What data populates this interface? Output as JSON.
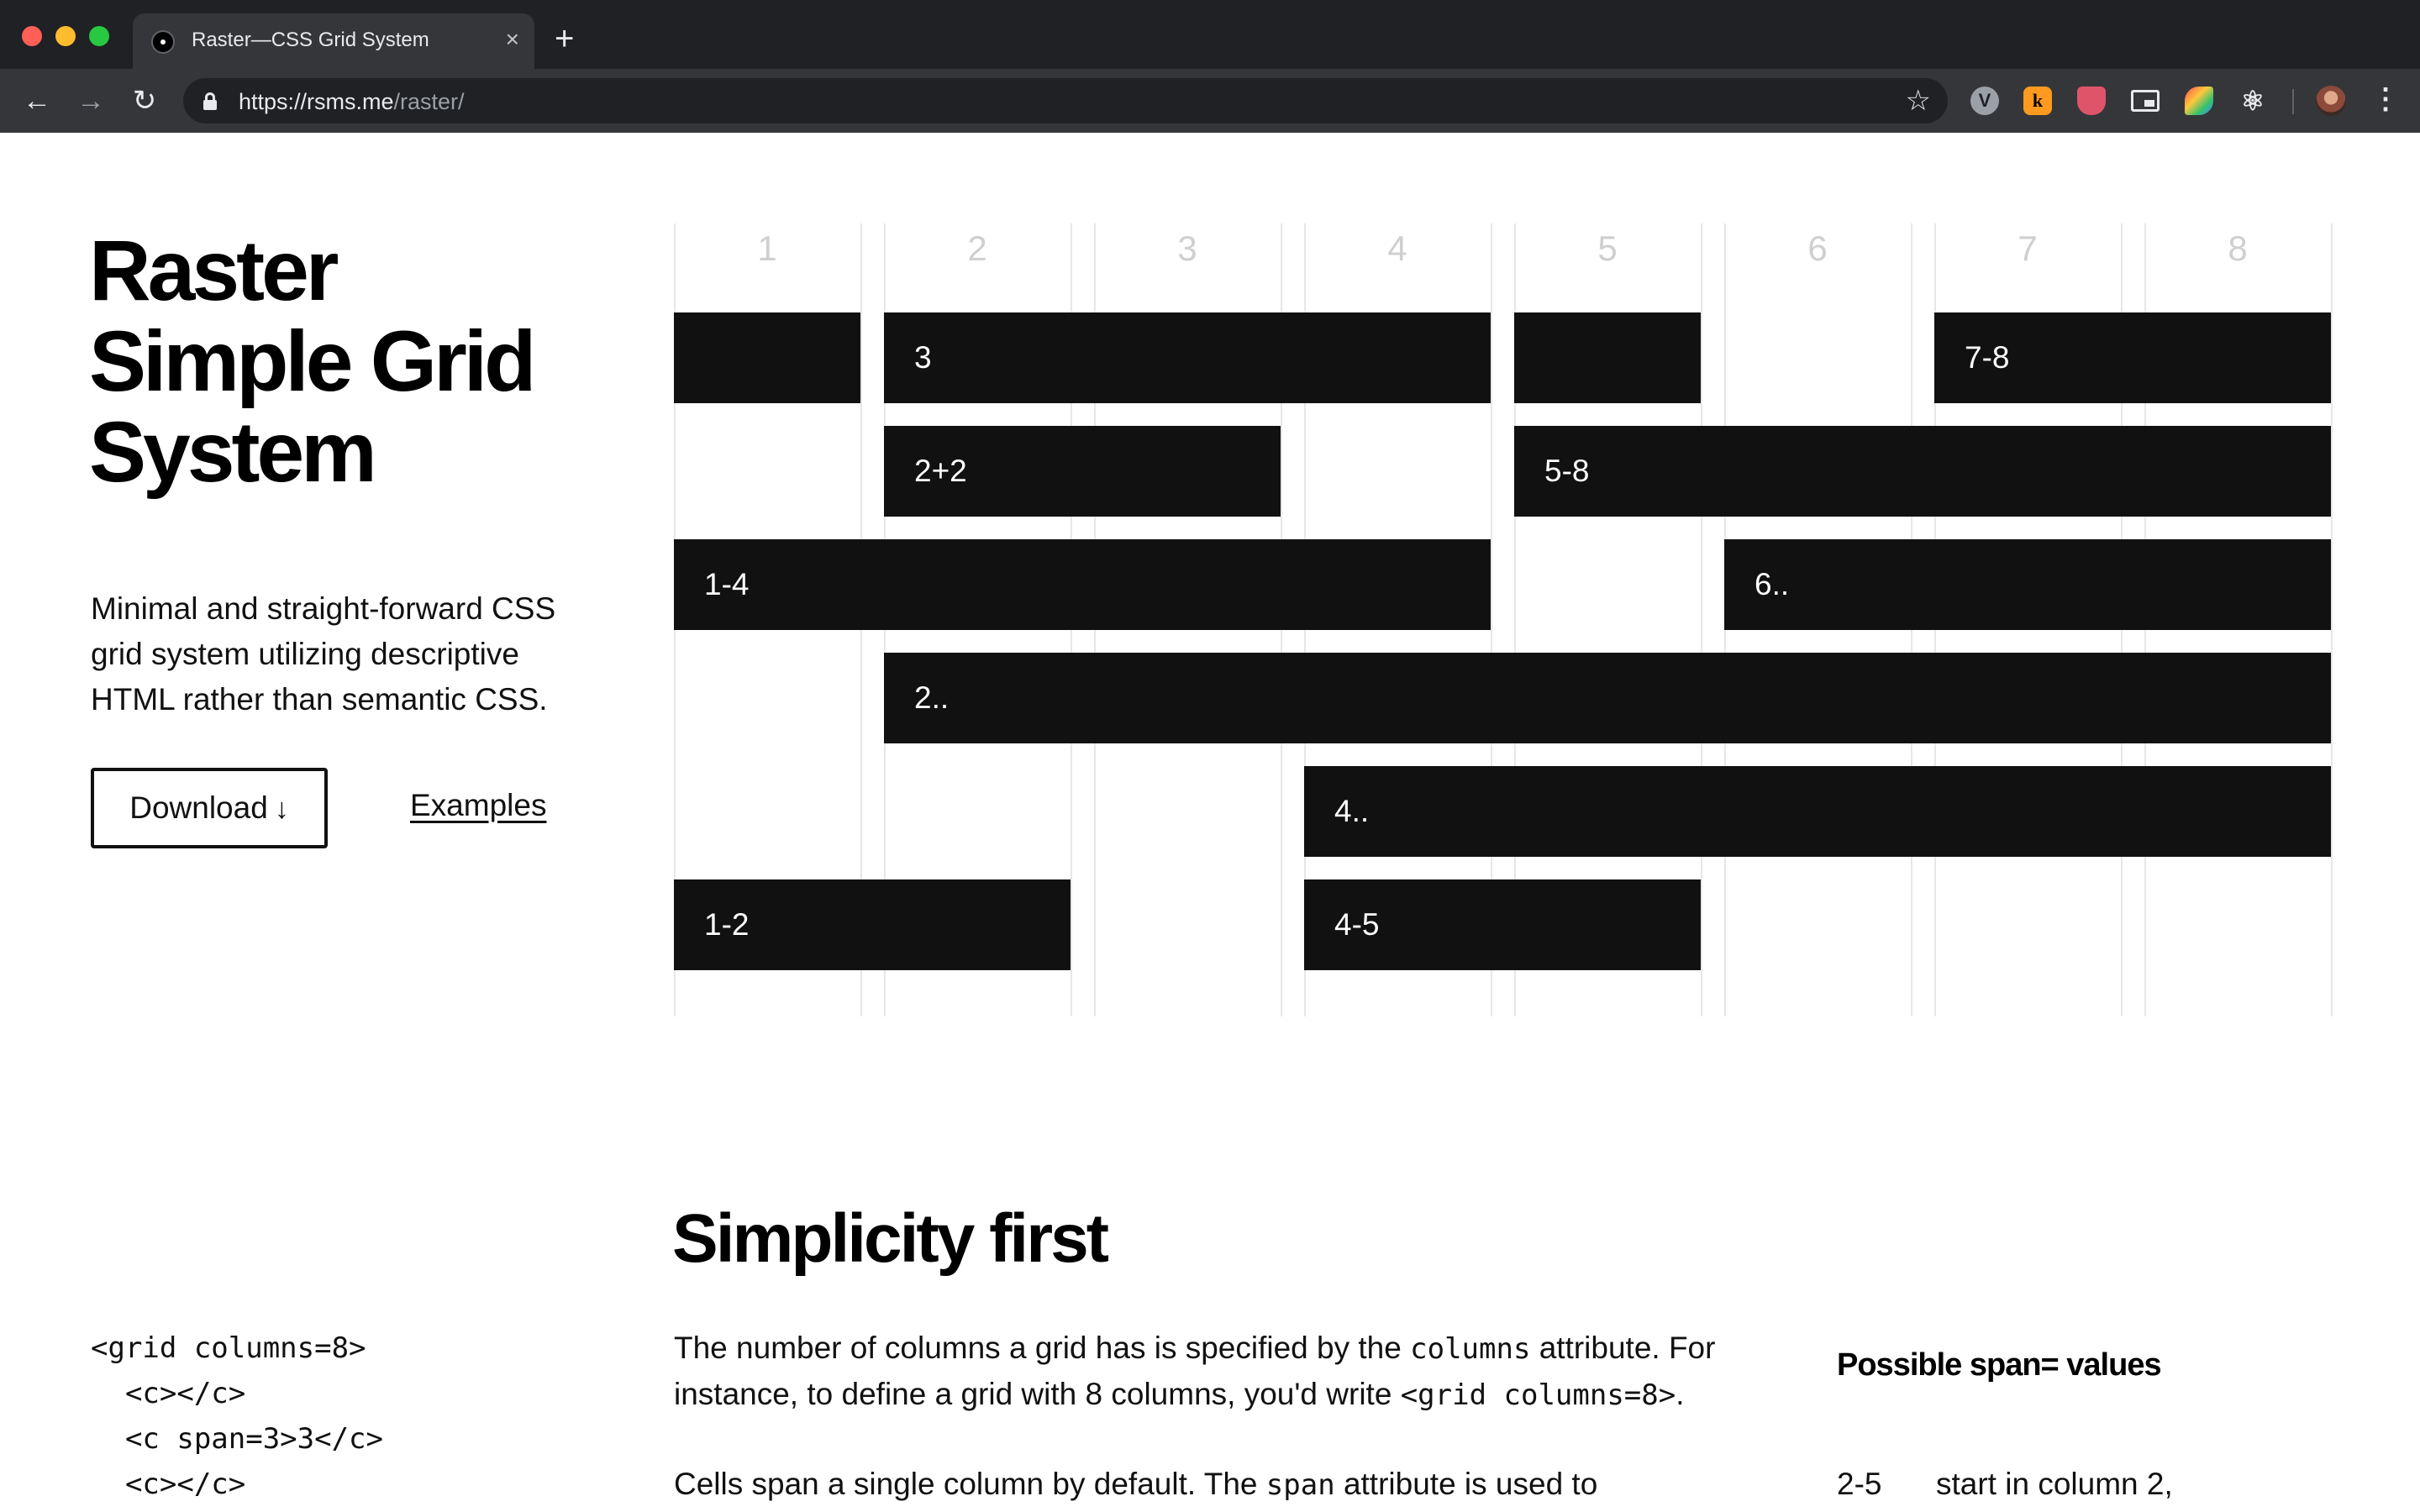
{
  "browser": {
    "tab_title": "Raster—CSS Grid System",
    "tab_close": "×",
    "new_tab": "+",
    "url_host": "https://rsms.me",
    "url_path": "/raster/",
    "back": "←",
    "forward": "→",
    "reload": "↻",
    "star": "☆",
    "ext_v": "V",
    "ext_k": "k",
    "ext_react": "⚛",
    "menu": "⋮"
  },
  "hero": {
    "title_lines": [
      "Raster",
      "Simple Grid",
      "System"
    ],
    "description": "Minimal and straight-forward CSS grid system utilizing descriptive HTML rather than semantic CSS.",
    "download_label": "Download",
    "download_arrow": "↓",
    "examples_label": "Examples"
  },
  "grid_demo": {
    "column_numbers": [
      "1",
      "2",
      "3",
      "4",
      "5",
      "6",
      "7",
      "8"
    ],
    "cells": [
      {
        "label": "",
        "start": 1,
        "span": 1,
        "row": 1
      },
      {
        "label": "3",
        "start": 2,
        "span": 3,
        "row": 1
      },
      {
        "label": "",
        "start": 5,
        "span": 1,
        "row": 1
      },
      {
        "label": "7-8",
        "start": 7,
        "span": 2,
        "row": 1
      },
      {
        "label": "2+2",
        "start": 2,
        "span": 2,
        "row": 2
      },
      {
        "label": "5-8",
        "start": 5,
        "span": 4,
        "row": 2
      },
      {
        "label": "1-4",
        "start": 1,
        "span": 4,
        "row": 3
      },
      {
        "label": "6..",
        "start": 6,
        "span": 3,
        "row": 3
      },
      {
        "label": "2..",
        "start": 2,
        "span": 7,
        "row": 4
      },
      {
        "label": "4..",
        "start": 4,
        "span": 5,
        "row": 5
      },
      {
        "label": "1-2",
        "start": 1,
        "span": 2,
        "row": 6
      },
      {
        "label": "4-5",
        "start": 4,
        "span": 2,
        "row": 6
      }
    ]
  },
  "simplicity": {
    "title": "Simplicity first",
    "code_lines": [
      "<grid columns=8>",
      "  <c></c>",
      "  <c span=3>3</c>",
      "  <c></c>"
    ],
    "para1_a": "The number of columns a grid has is specified by the ",
    "para1_code1": "columns",
    "para1_b": " attribute. For instance, to define a grid with 8 columns, you'd write ",
    "para1_code2": "<grid columns=8>",
    "para1_c": ".",
    "para2_a": "Cells span a single column by default. The ",
    "para2_code": "span",
    "para2_b": " attribute is used to",
    "aside_title": "Possible span= values",
    "span_rows": [
      {
        "key": "2-5",
        "desc": "start in column 2,"
      }
    ]
  }
}
